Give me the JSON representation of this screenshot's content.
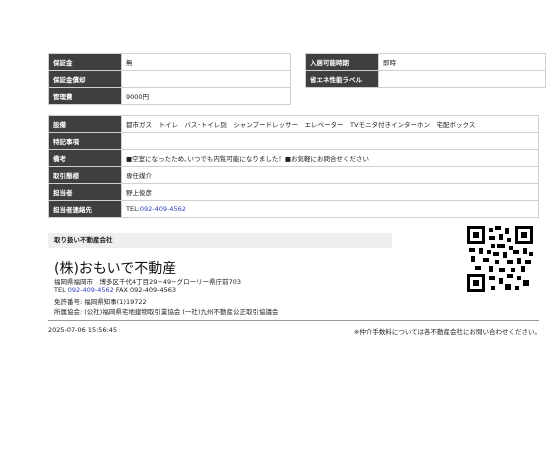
{
  "top_table": {
    "rows": [
      {
        "l1": "保証金",
        "v1": "無",
        "l2": "入居可能時期",
        "v2": "即時"
      },
      {
        "l1": "保証金償却",
        "v1": "",
        "l2": "省エネ性能ラベル",
        "v2": ""
      },
      {
        "l1": "管理費",
        "v1": "9000円"
      }
    ]
  },
  "detail_table": {
    "rows": [
      {
        "label": "設備",
        "value": "都市ガス　トイレ　バス･トイレ別　シャンプードレッサー　エレベーター　TVモニタ付きインターホン　宅配ボックス"
      },
      {
        "label": "特記事項",
        "value": ""
      },
      {
        "label": "備考",
        "value": "■空室になったため､いつでも内覧可能になりました！■お気軽にお問合せください"
      },
      {
        "label": "取引態様",
        "value": "専任媒介"
      },
      {
        "label": "担当者",
        "value": "野上俊彦"
      },
      {
        "label": "担当者連絡先",
        "prefix": "TEL:",
        "value": "092-409-4562"
      }
    ]
  },
  "agency": {
    "heading": "取り扱い不動産会社",
    "name": "(株)おもいで不動産",
    "address": "福岡県福岡市　博多区千代4丁目29−49−グローリー県庁前703",
    "tel_label": "TEL ",
    "tel": "092-409-4562",
    "fax": " FAX 092-409-4563",
    "license": "免許番号: 福岡県知事(1)19722",
    "association": "所属協会: (公社)福岡県宅地建物取引業協会 (一社)九州不動産公正取引協議会"
  },
  "footer": {
    "timestamp": "2025-07-06 15:56:45",
    "note": "※仲介手数料については各不動産会社にお問い合わせください。"
  },
  "colors": {
    "label_bg": "#3f3f3f",
    "link": "#2a3fbf"
  },
  "icons": {
    "qr": "qr-code-icon"
  }
}
